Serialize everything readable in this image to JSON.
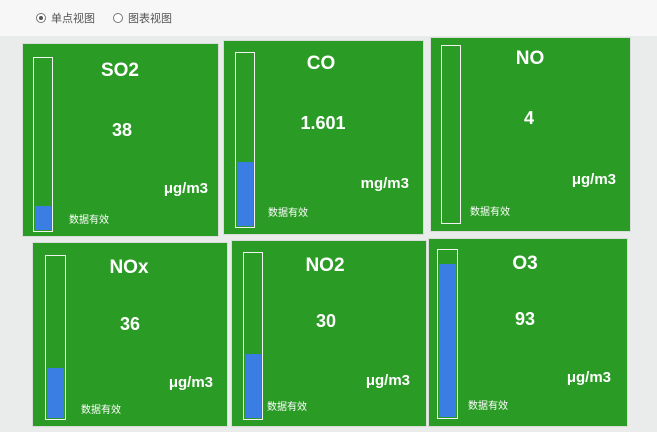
{
  "view_options": [
    {
      "label": "单点视图",
      "selected": true
    },
    {
      "label": "图表视图",
      "selected": false
    }
  ],
  "status_text": "数据有效",
  "colors": {
    "panel": "#2a9b24",
    "gauge_fill": "#3b7ee3"
  },
  "panels": [
    {
      "name": "SO2",
      "value": "38",
      "unit": "μg/m3",
      "level": 0.15
    },
    {
      "name": "CO",
      "value": "1.601",
      "unit": "mg/m3",
      "level": 0.38
    },
    {
      "name": "NO",
      "value": "4",
      "unit": "μg/m3",
      "level": 0.0
    },
    {
      "name": "NOx",
      "value": "36",
      "unit": "μg/m3",
      "level": 0.32
    },
    {
      "name": "NO2",
      "value": "30",
      "unit": "μg/m3",
      "level": 0.4
    },
    {
      "name": "O3",
      "value": "93",
      "unit": "μg/m3",
      "level": 0.92
    }
  ]
}
